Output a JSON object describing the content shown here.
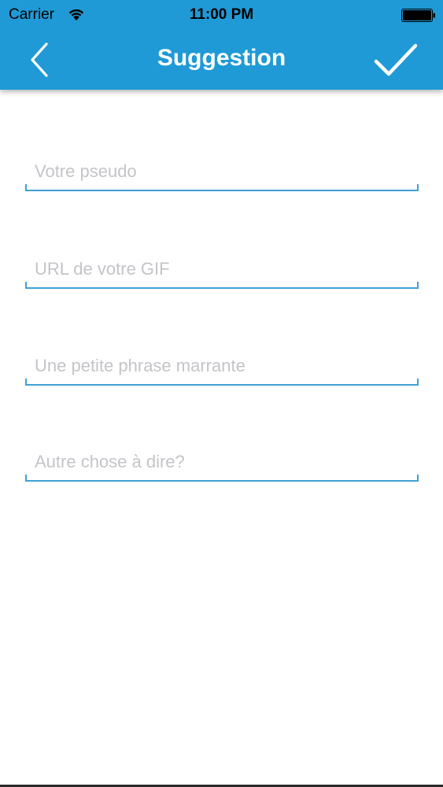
{
  "status_bar": {
    "carrier": "Carrier",
    "time": "11:00 PM",
    "wifi_icon": "wifi-icon",
    "battery_icon": "battery-icon"
  },
  "nav": {
    "title": "Suggestion",
    "back_icon": "chevron-left-icon",
    "confirm_icon": "checkmark-icon",
    "bar_color": "#1f9ad6"
  },
  "form": {
    "fields": [
      {
        "placeholder": "Votre pseudo",
        "value": ""
      },
      {
        "placeholder": "URL de votre GIF",
        "value": ""
      },
      {
        "placeholder": "Une petite phrase marrante",
        "value": ""
      },
      {
        "placeholder": "Autre chose à dire?",
        "value": ""
      }
    ],
    "underline_color": "#3da2d4"
  }
}
